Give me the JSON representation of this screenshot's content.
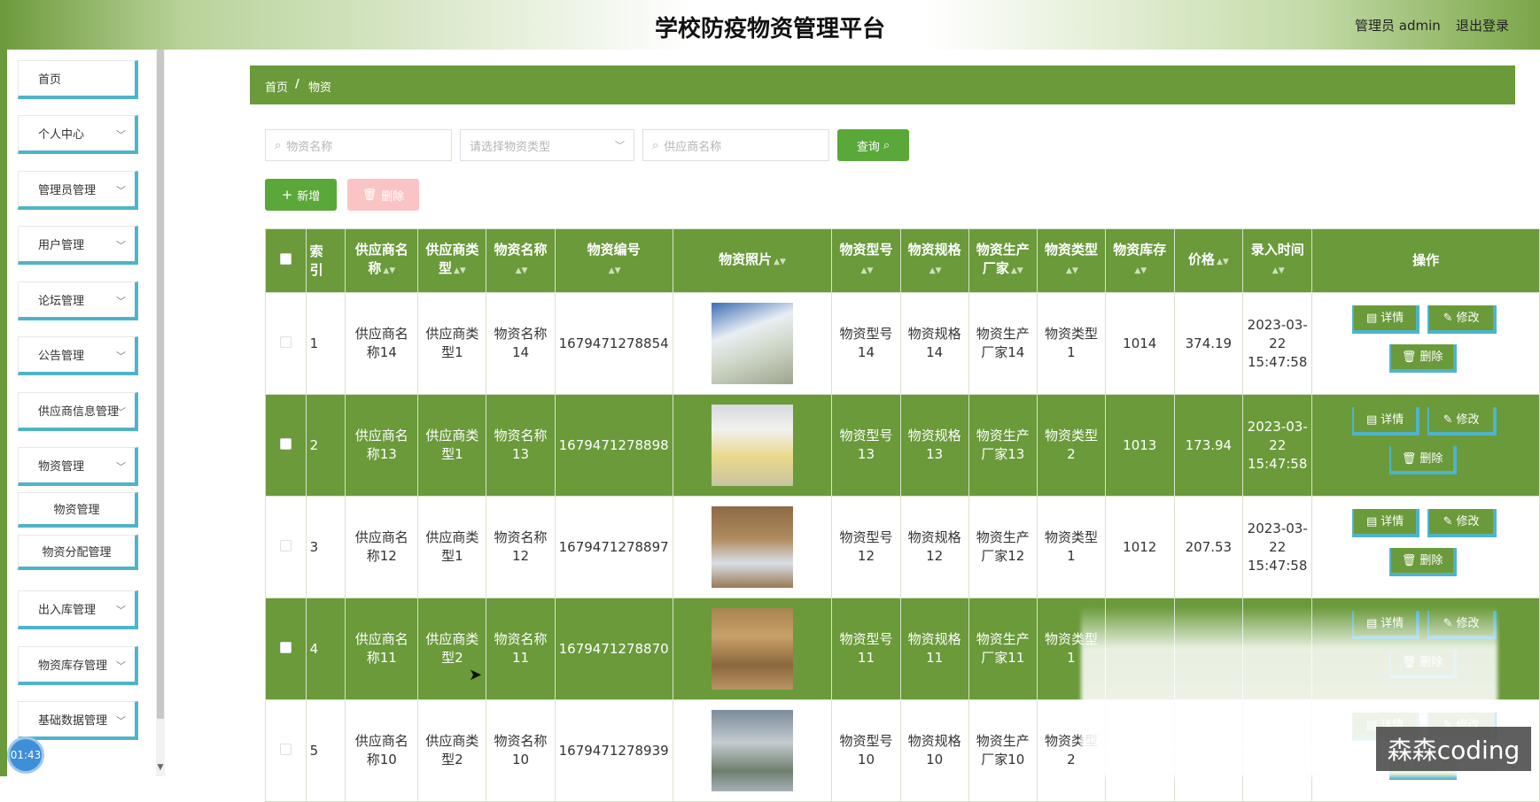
{
  "header": {
    "title": "学校防疫物资管理平台",
    "user": "管理员 admin",
    "logout": "退出登录"
  },
  "sidebar": {
    "items": [
      {
        "label": "首页"
      },
      {
        "label": "个人中心"
      },
      {
        "label": "管理员管理"
      },
      {
        "label": "用户管理"
      },
      {
        "label": "论坛管理"
      },
      {
        "label": "公告管理"
      },
      {
        "label": "供应商信息管理"
      },
      {
        "label": "物资管理"
      },
      {
        "label": "出入库管理"
      },
      {
        "label": "物资库存管理"
      },
      {
        "label": "基础数据管理"
      }
    ],
    "sub_items": [
      {
        "label": "物资管理"
      },
      {
        "label": "物资分配管理"
      }
    ],
    "time_badge": "01:43"
  },
  "breadcrumb": {
    "home": "首页",
    "sep": "/",
    "current": "物资"
  },
  "search": {
    "name_placeholder": "物资名称",
    "type_placeholder": "请选择物资类型",
    "supplier_placeholder": "供应商名称",
    "query_label": "查询"
  },
  "actions": {
    "add_label": "新增",
    "delete_label": "删除"
  },
  "table": {
    "headers": [
      "索引",
      "供应商名称",
      "供应商类型",
      "物资名称",
      "物资编号",
      "物资照片",
      "物资型号",
      "物资规格",
      "物资生产厂家",
      "物资类型",
      "物资库存",
      "价格",
      "录入时间",
      "操作"
    ],
    "header_display": {
      "index": "索\n引",
      "supplier_name": "供应商名\n称",
      "supplier_type": "供应商类\n型",
      "name": "物资名称",
      "code": "物资编号",
      "photo": "物资照片",
      "model": "物资型号",
      "spec": "物资规格",
      "maker": "物资生产\n厂家",
      "type": "物资类型",
      "stock": "物资库存",
      "price": "价格",
      "time": "录入时间",
      "ops": "操作"
    },
    "ops_labels": {
      "detail": "详情",
      "edit": "修改",
      "delete": "删除"
    },
    "rows": [
      {
        "index": "1",
        "supplier_name": "供应商名称14",
        "supplier_type": "供应商类型1",
        "name": "物资名称14",
        "code": "1679471278854",
        "model": "物资型号14",
        "spec": "物资规格14",
        "maker": "物资生产厂家14",
        "type": "物资类型1",
        "stock": "1014",
        "price": "374.19",
        "time": "2023-03-22 15:47:58"
      },
      {
        "index": "2",
        "supplier_name": "供应商名称13",
        "supplier_type": "供应商类型1",
        "name": "物资名称13",
        "code": "1679471278898",
        "model": "物资型号13",
        "spec": "物资规格13",
        "maker": "物资生产厂家13",
        "type": "物资类型2",
        "stock": "1013",
        "price": "173.94",
        "time": "2023-03-22 15:47:58"
      },
      {
        "index": "3",
        "supplier_name": "供应商名称12",
        "supplier_type": "供应商类型1",
        "name": "物资名称12",
        "code": "1679471278897",
        "model": "物资型号12",
        "spec": "物资规格12",
        "maker": "物资生产厂家12",
        "type": "物资类型1",
        "stock": "1012",
        "price": "207.53",
        "time": "2023-03-22 15:47:58"
      },
      {
        "index": "4",
        "supplier_name": "供应商名称11",
        "supplier_type": "供应商类型2",
        "name": "物资名称11",
        "code": "1679471278870",
        "model": "物资型号11",
        "spec": "物资规格11",
        "maker": "物资生产厂家11",
        "type": "物资类型1",
        "stock": "",
        "price": "",
        "time": ""
      },
      {
        "index": "5",
        "supplier_name": "供应商名称10",
        "supplier_type": "供应商类型2",
        "name": "物资名称10",
        "code": "1679471278939",
        "model": "物资型号10",
        "spec": "物资规格10",
        "maker": "物资生产厂家10",
        "type": "物资类型2",
        "stock": "",
        "price": "",
        "time": ""
      }
    ]
  },
  "watermark": "森森coding",
  "colors": {
    "accent": "#6a9a3a",
    "button_green": "#5aa73a",
    "highlight_border": "#4fb3c9"
  }
}
